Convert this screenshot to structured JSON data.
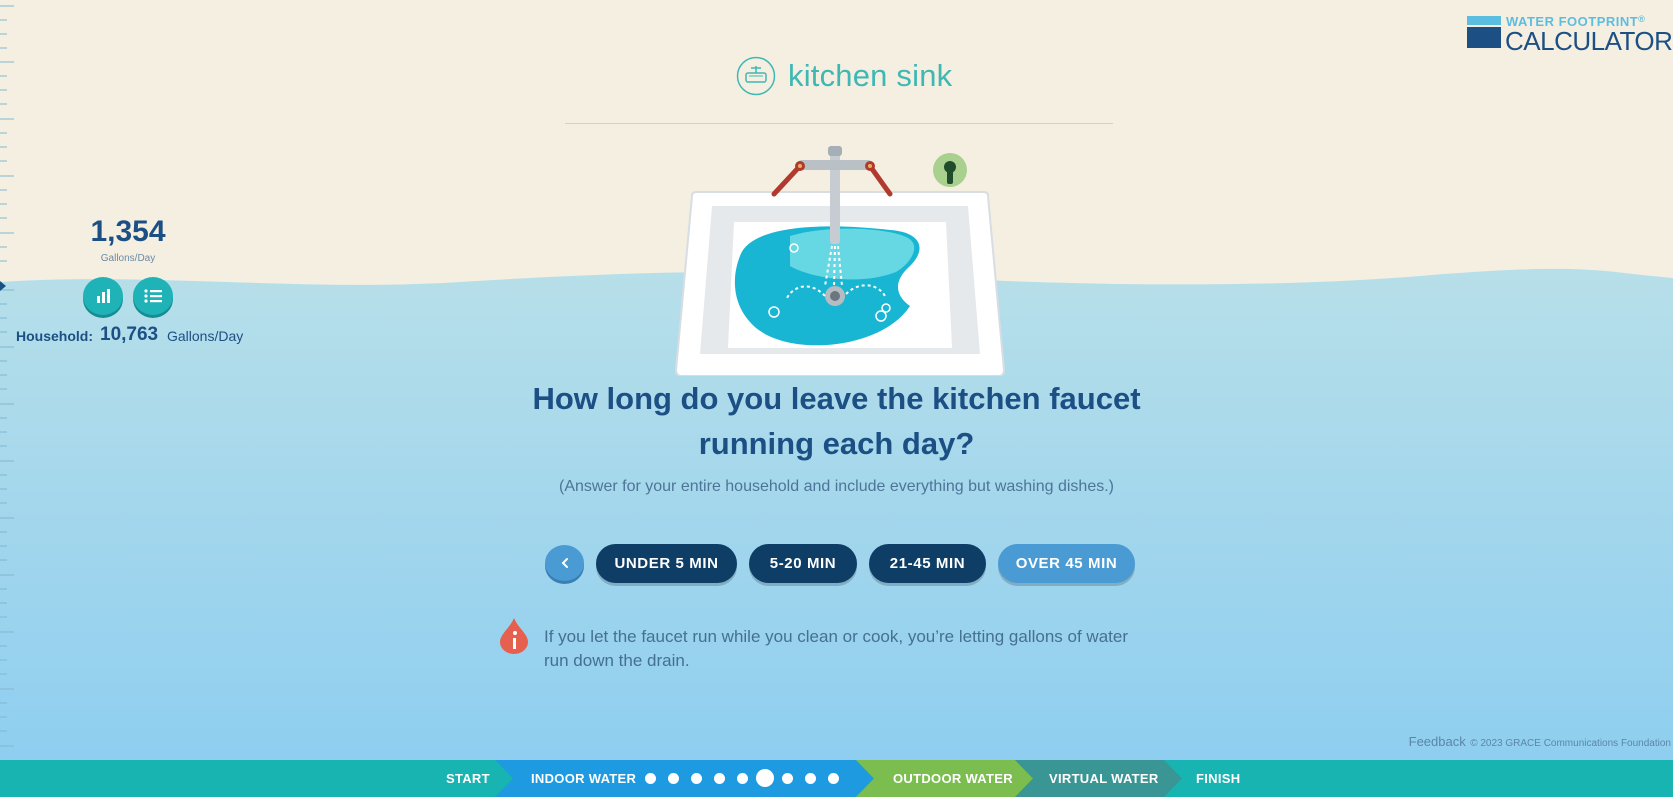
{
  "logo": {
    "line1": "WATER FOOTPRINT",
    "reg": "®",
    "line2": "CALCULATOR"
  },
  "header": {
    "title": "kitchen sink",
    "icon": "kitchen-sink-icon"
  },
  "stats": {
    "personal_value": "1,354",
    "personal_unit": "Gallons/Day",
    "household_label": "Household:",
    "household_value": "10,763",
    "household_unit": "Gallons/Day",
    "buttons": [
      {
        "name": "chart-icon"
      },
      {
        "name": "list-icon"
      }
    ]
  },
  "question": {
    "line1": "How long do you leave the kitchen faucet",
    "line2": "running each day?",
    "hint": "(Answer for your entire household and include everything but washing dishes.)"
  },
  "answers": {
    "back_icon": "chevron-left-icon",
    "options": [
      "UNDER 5 MIN",
      "5-20 MIN",
      "21-45 MIN",
      "OVER 45 MIN"
    ],
    "highlighted": "OVER 45 MIN"
  },
  "tip": {
    "icon": "info-drop-icon",
    "text": "If you let the faucet run while you clean or cook, you’re letting gallons of water run down the drain."
  },
  "footer": {
    "feedback": "Feedback",
    "copyright": "© 2023 GRACE Communications Foundation"
  },
  "progress": {
    "steps": [
      "START",
      "INDOOR WATER",
      "OUTDOOR WATER",
      "VIRTUAL WATER",
      "FINISH"
    ],
    "current_step": "INDOOR WATER",
    "indoor_substeps_total": 9,
    "indoor_substep_current": 5
  },
  "colors": {
    "navy": "#1c4f84",
    "teal": "#1fb3b8",
    "answer_dark": "#0e3d66",
    "answer_light": "#4a9ad4",
    "sand": "#f5efe2",
    "tip_red": "#e5604e"
  }
}
